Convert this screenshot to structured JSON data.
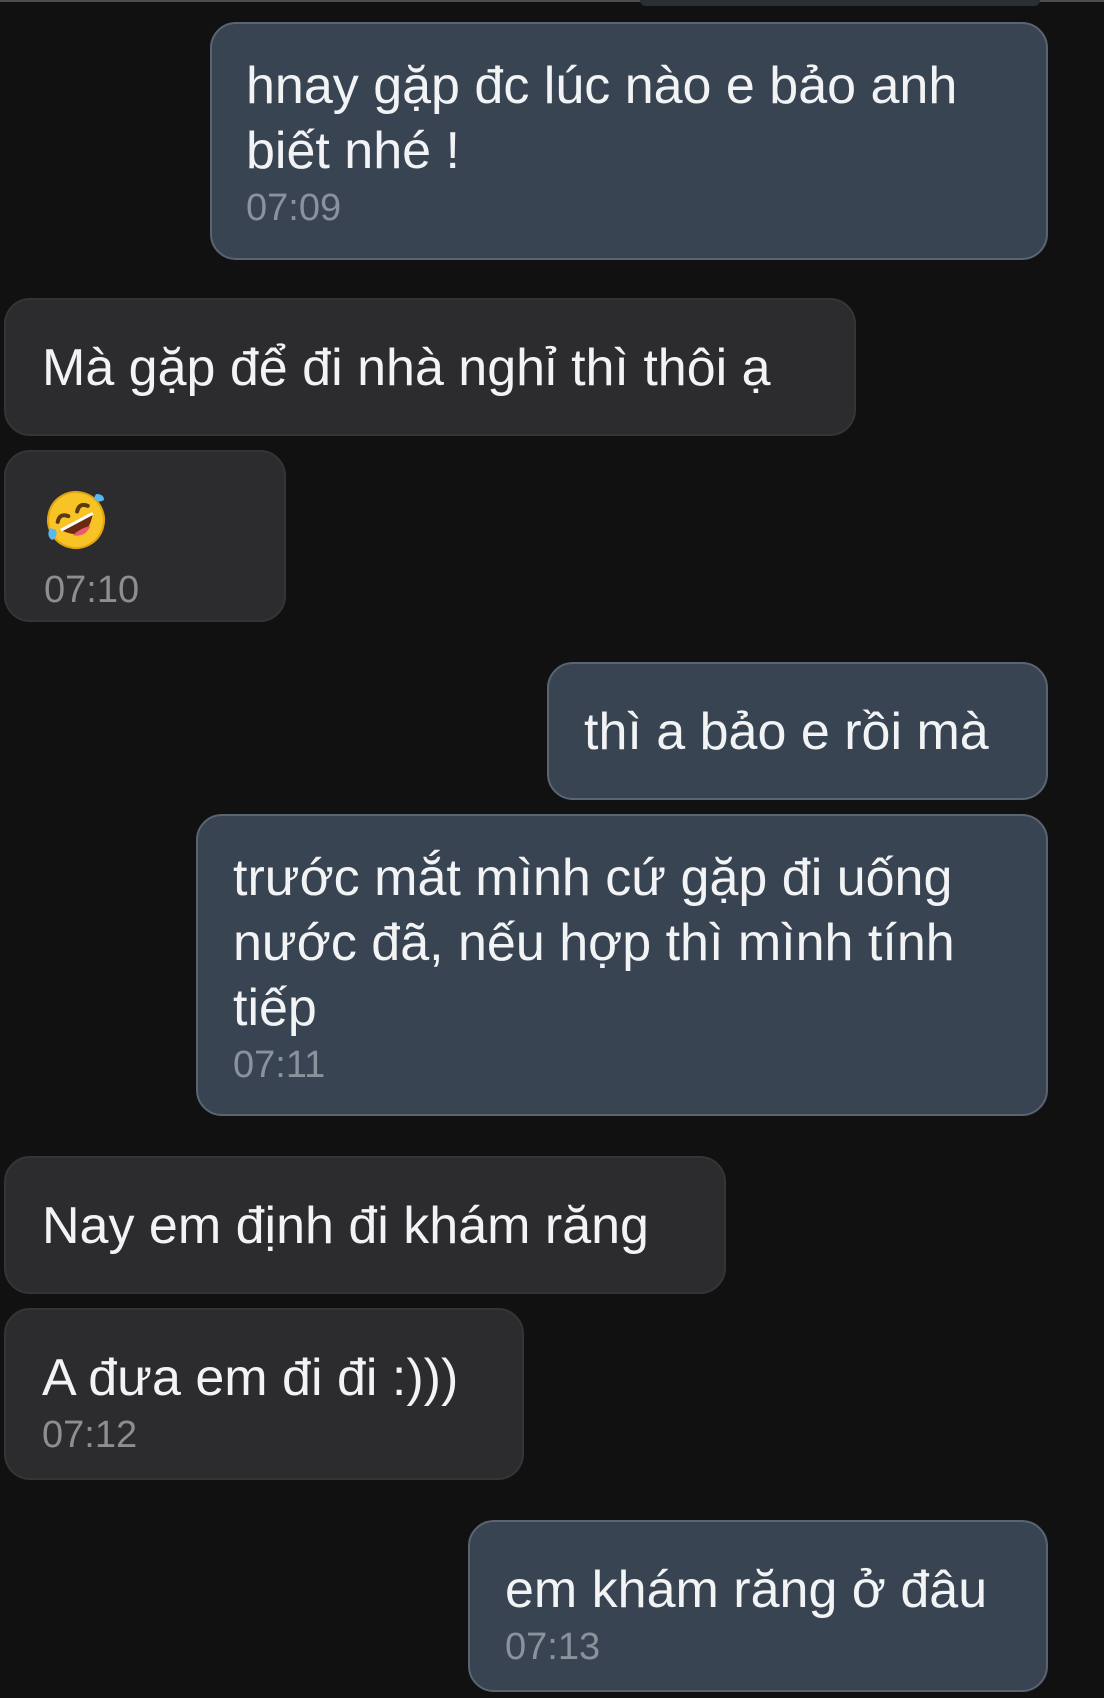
{
  "messages": [
    {
      "id": "m1",
      "direction": "out",
      "text": "hnay gặp đc lúc nào e bảo anh\nbiết nhé !",
      "time": "07:09"
    },
    {
      "id": "m2",
      "direction": "in",
      "text": "Mà gặp để đi nhà nghỉ thì thôi ạ"
    },
    {
      "id": "m3",
      "direction": "in",
      "emoji": "rolling-on-the-floor-laughing",
      "time": "07:10"
    },
    {
      "id": "m4",
      "direction": "out",
      "text": "thì a bảo e rồi mà"
    },
    {
      "id": "m5",
      "direction": "out",
      "text": "trước mắt mình cứ gặp đi uống\nnước đã, nếu hợp thì mình tính\ntiếp",
      "time": "07:11"
    },
    {
      "id": "m6",
      "direction": "in",
      "text": "Nay em định đi khám răng"
    },
    {
      "id": "m7",
      "direction": "in",
      "text": "A đưa em đi đi :)))",
      "time": "07:12"
    },
    {
      "id": "m8",
      "direction": "out",
      "text": "em khám răng ở đâu",
      "time": "07:13"
    }
  ],
  "colors": {
    "background": "#111112",
    "outgoing_bubble": "#394452",
    "incoming_bubble": "#2c2c2e",
    "text": "#f2f3f5",
    "timestamp": "#8a929c"
  }
}
